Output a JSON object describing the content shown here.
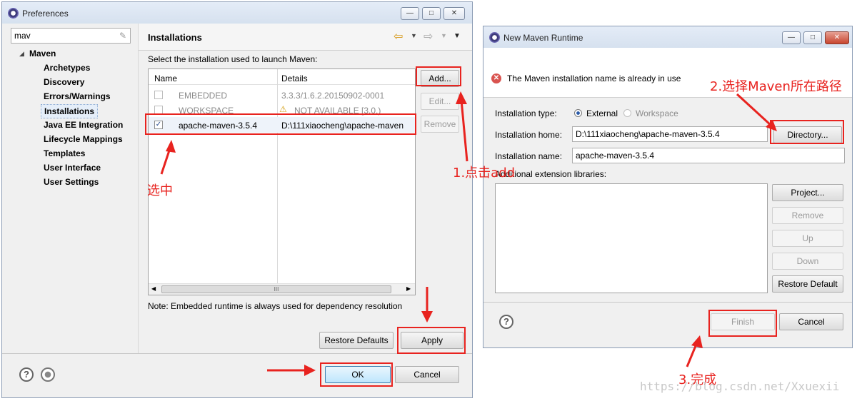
{
  "preferences": {
    "title": "Preferences",
    "window_buttons": [
      "—",
      "□",
      "✕"
    ],
    "filter_value": "mav",
    "tree": {
      "root": "Maven",
      "items": [
        "Archetypes",
        "Discovery",
        "Errors/Warnings",
        "Installations",
        "Java EE Integration",
        "Lifecycle Mappings",
        "Templates",
        "User Interface",
        "User Settings"
      ]
    },
    "page_title": "Installations",
    "description": "Select the installation used to launch Maven:",
    "table": {
      "columns": [
        "Name",
        "Details"
      ],
      "rows": [
        {
          "name": "EMBEDDED",
          "details": "3.3.3/1.6.2.20150902-0001",
          "checked": false
        },
        {
          "name": "WORKSPACE",
          "details": "NOT AVAILABLE [3.0,)",
          "checked": false
        },
        {
          "name": "apache-maven-3.5.4",
          "details": "D:\\111xiaocheng\\apache-maven",
          "checked": true
        }
      ],
      "scroll_grip": "III"
    },
    "buttons": {
      "add": "Add...",
      "edit": "Edit...",
      "remove": "Remove",
      "restore_defaults": "Restore Defaults",
      "apply": "Apply",
      "ok": "OK",
      "cancel": "Cancel"
    },
    "note": "Note: Embedded runtime is always used for dependency resolution"
  },
  "maven_dialog": {
    "title": "New Maven Runtime",
    "window_buttons": [
      "—",
      "□",
      "✕"
    ],
    "error": "The Maven installation name is already in use",
    "installation_type_label": "Installation type:",
    "type_external": "External",
    "type_workspace": "Workspace",
    "home_label": "Installation home:",
    "home_value": "D:\\111xiaocheng\\apache-maven-3.5.4",
    "name_label": "Installation name:",
    "name_value": "apache-maven-3.5.4",
    "ext_libs_label": "Additional extension libraries:",
    "buttons": {
      "directory": "Directory...",
      "project": "Project...",
      "remove": "Remove",
      "up": "Up",
      "down": "Down",
      "restore_default": "Restore Default",
      "finish": "Finish",
      "cancel": "Cancel"
    }
  },
  "annotations": {
    "select": "选中",
    "step1": "1.点击add",
    "step2": "2.选择Maven所在路径",
    "step3": "3.完成"
  },
  "watermark": "https://blog.csdn.net/Xxuexii",
  "colors": {
    "annotation": "#e8231f",
    "titlebar": "#dbe5f2",
    "selection": "#d6e4f5"
  }
}
